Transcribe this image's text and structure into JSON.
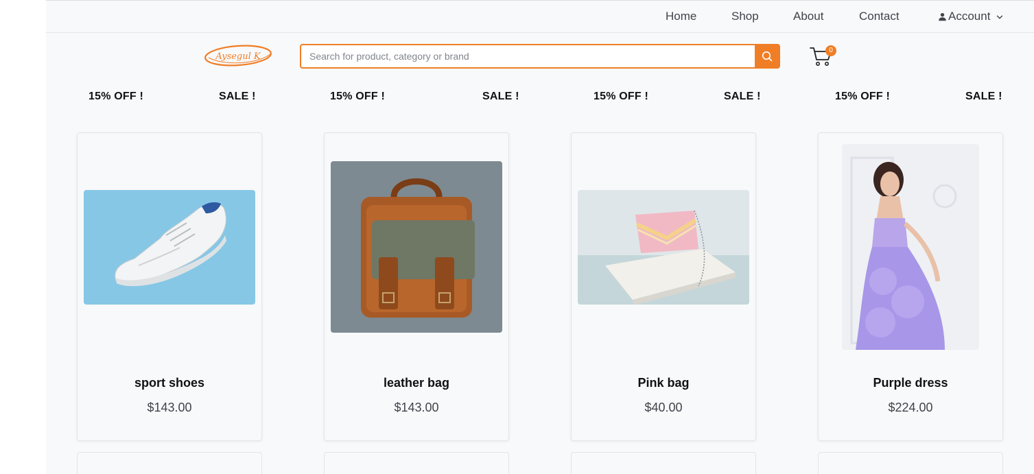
{
  "nav": {
    "links": [
      "Home",
      "Shop",
      "About",
      "Contact"
    ],
    "account_label": "Account"
  },
  "header": {
    "logo_text": "Aysegul K",
    "search_placeholder": "Search for product, category or brand",
    "cart_count": "0"
  },
  "promo": [
    "15% OFF !",
    "SALE !",
    "15% OFF !",
    "SALE !",
    "15% OFF !",
    "SALE !",
    "15% OFF !",
    "SALE !"
  ],
  "products": [
    {
      "name": "sport shoes",
      "price": "$143.00",
      "image": "white-sneaker-on-blue"
    },
    {
      "name": "leather bag",
      "price": "$143.00",
      "image": "brown-leather-briefcase"
    },
    {
      "name": "Pink bag",
      "price": "$40.00",
      "image": "pink-chain-handbag"
    },
    {
      "name": "Purple dress",
      "price": "$224.00",
      "image": "woman-in-purple-gown"
    }
  ],
  "colors": {
    "accent": "#f07e26",
    "background": "#f8f9fb",
    "text": "#3f444b"
  }
}
